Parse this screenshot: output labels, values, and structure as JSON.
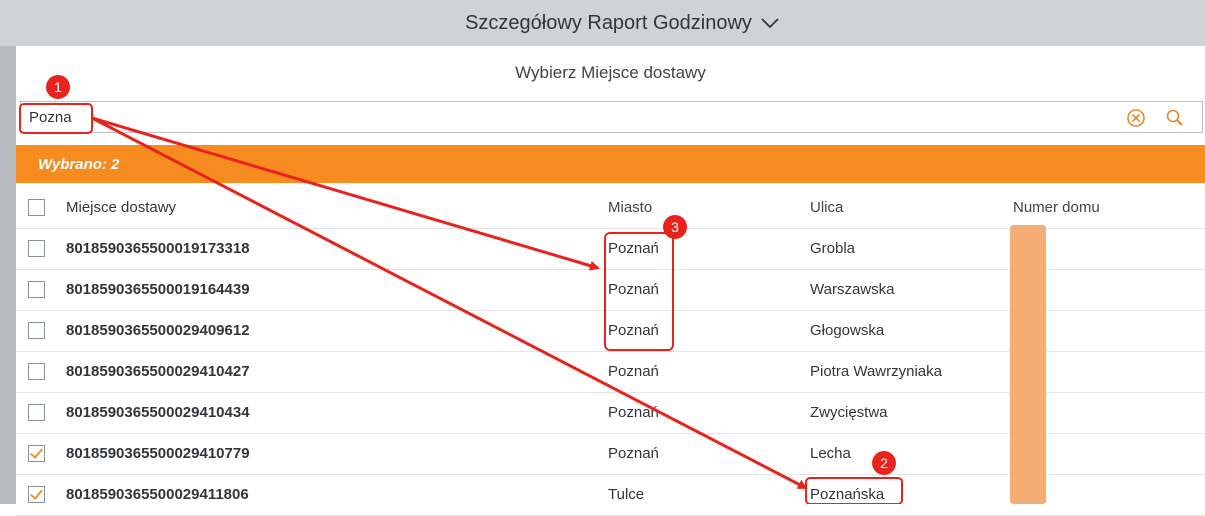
{
  "app": {
    "title": "Szczegółowy Raport Godzinowy"
  },
  "dialog": {
    "title": "Wybierz Miejsce dostawy",
    "search": {
      "value": "Pozna",
      "placeholder": ""
    },
    "selection": {
      "label": "Wybrano: 2"
    },
    "columns": [
      "Miejsce dostawy",
      "Miasto",
      "Ulica",
      "Numer domu"
    ],
    "rows": [
      {
        "checked": false,
        "id": "8018590365500019173318",
        "city": "Poznań",
        "street": "Grobla",
        "house": ""
      },
      {
        "checked": false,
        "id": "8018590365500019164439",
        "city": "Poznań",
        "street": "Warszawska",
        "house": ""
      },
      {
        "checked": false,
        "id": "8018590365500029409612",
        "city": "Poznań",
        "street": "Głogowska",
        "house": ""
      },
      {
        "checked": false,
        "id": "8018590365500029410427",
        "city": "Poznań",
        "street": "Piotra Wawrzyniaka",
        "house": ""
      },
      {
        "checked": false,
        "id": "8018590365500029410434",
        "city": "Poznań",
        "street": "Zwycięstwa",
        "house": ""
      },
      {
        "checked": true,
        "id": "8018590365500029410779",
        "city": "Poznań",
        "street": "Lecha",
        "house": ""
      },
      {
        "checked": true,
        "id": "8018590365500029411806",
        "city": "Tulce",
        "street": "Poznańska",
        "house": ""
      }
    ]
  },
  "annotations": {
    "badges": [
      "1",
      "2",
      "3"
    ],
    "color": "#e8231e"
  },
  "icons": {
    "clear": "clear-circle-icon",
    "search": "search-icon",
    "title_dropdown": "chevron-down-icon"
  },
  "colors": {
    "accent": "#f68c1f",
    "icon": "#e8892b",
    "annotation": "#e8231e",
    "redaction": "#f4ad75"
  }
}
